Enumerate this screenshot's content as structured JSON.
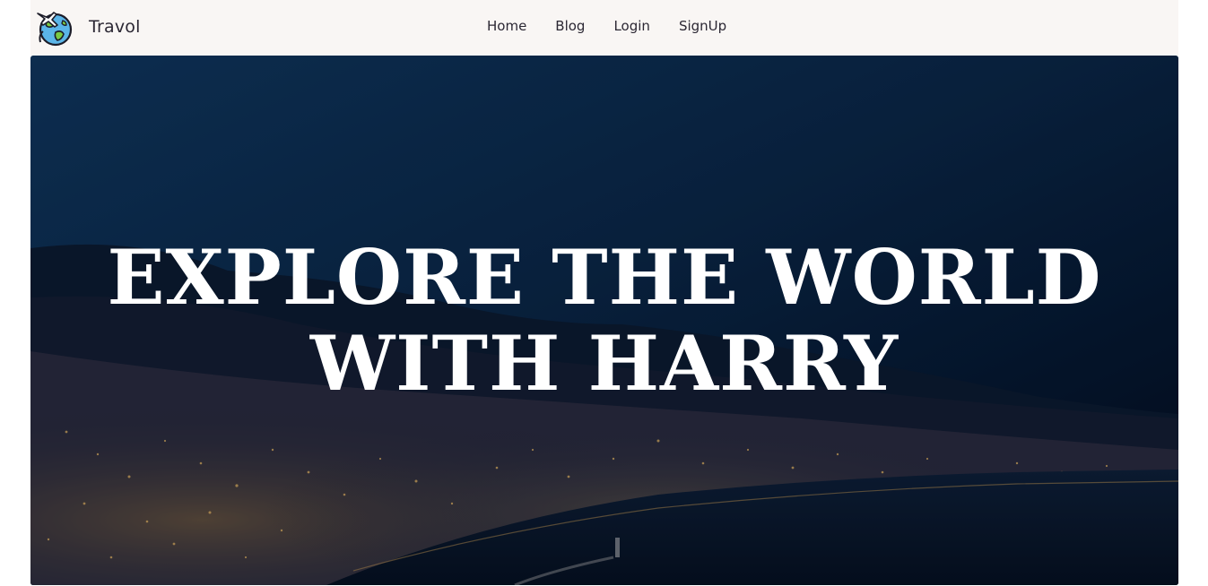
{
  "brand": {
    "name": "Travol",
    "logo_icon": "globe-airplane-icon"
  },
  "nav": {
    "items": [
      {
        "label": "Home"
      },
      {
        "label": "Blog"
      },
      {
        "label": "Login"
      },
      {
        "label": "SignUp"
      }
    ]
  },
  "hero": {
    "title_line1": "EXPLORE THE WORLD",
    "title_line2": "WITH HARRY",
    "image": "night-city-coastline-photo"
  },
  "colors": {
    "navbar_bg": "#f9f6f4",
    "text": "#2b2733",
    "hero_text": "#ffffff",
    "hero_sky": "#0b2a4a"
  }
}
